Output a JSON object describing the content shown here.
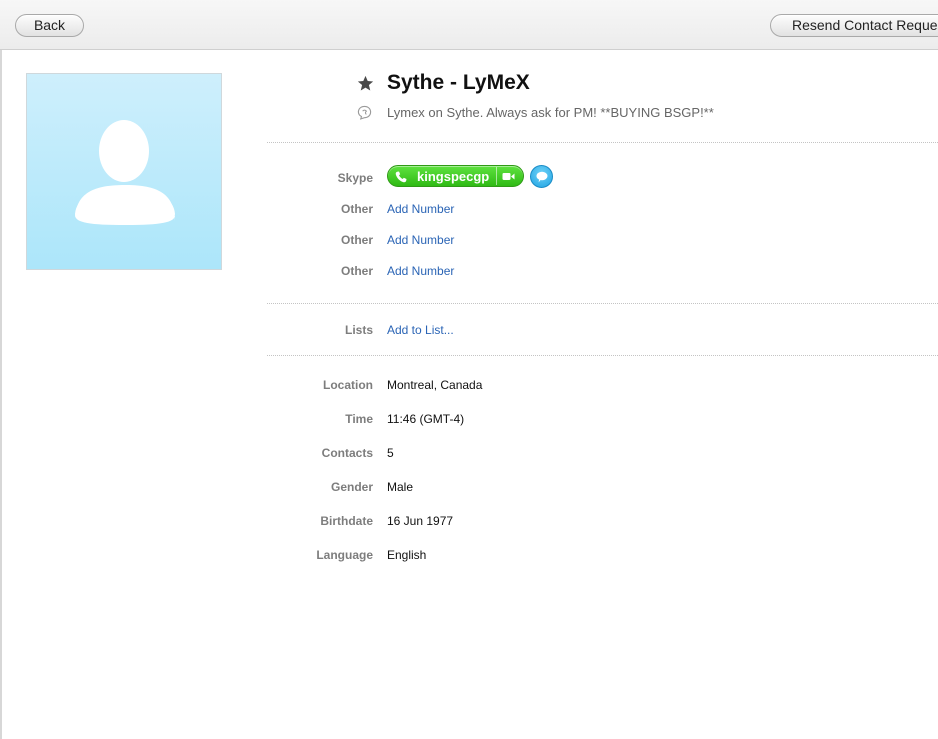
{
  "toolbar": {
    "back_label": "Back",
    "resend_label": "Resend Contact Request"
  },
  "profile": {
    "name": "Sythe - LyMeX",
    "mood": "Lymex on Sythe. Always ask for PM! **BUYING BSGP!**"
  },
  "skype": {
    "label": "Skype",
    "username": "kingspecgp",
    "call_color": "#2fba15"
  },
  "phones": [
    {
      "label": "Other",
      "action": "Add Number"
    },
    {
      "label": "Other",
      "action": "Add Number"
    },
    {
      "label": "Other",
      "action": "Add Number"
    }
  ],
  "lists": {
    "label": "Lists",
    "action": "Add to List..."
  },
  "details": [
    {
      "label": "Location",
      "value": "Montreal, Canada"
    },
    {
      "label": "Time",
      "value": "11:46 (GMT-4)"
    },
    {
      "label": "Contacts",
      "value": "5"
    },
    {
      "label": "Gender",
      "value": "Male"
    },
    {
      "label": "Birthdate",
      "value": "16 Jun 1977"
    },
    {
      "label": "Language",
      "value": "English"
    }
  ],
  "colors": {
    "link": "#2a64b5",
    "label": "#7d7d7d",
    "avatar_bg": "#b8e9fb"
  },
  "icons": {
    "favorite": "star-icon",
    "mood": "mood-message-icon",
    "call": "phone-icon",
    "video": "video-camera-icon",
    "chat": "chat-bubble-icon",
    "avatar": "default-avatar-silhouette"
  }
}
